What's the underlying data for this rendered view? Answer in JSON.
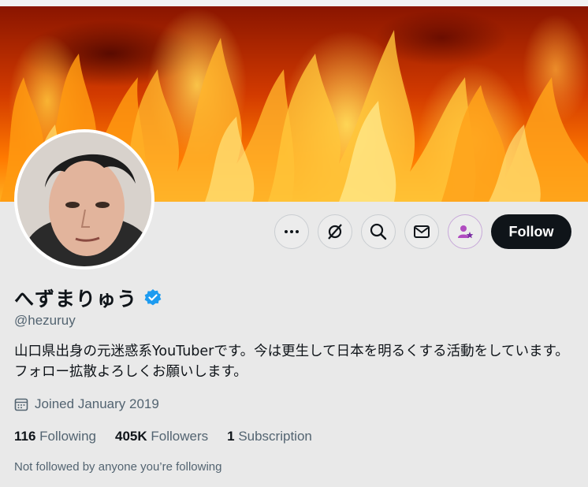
{
  "profile": {
    "display_name": "へずまりゅう",
    "handle": "@hezuruy",
    "bio": "山口県出身の元迷惑系YouTuberです。今は更生して日本を明るくする活動をしています。フォロー拡散よろしくお願いします。",
    "joined": "Joined January 2019",
    "verified_color": "#1d9bf0"
  },
  "actions": {
    "more_icon": "more-icon",
    "grok_icon": "grok-icon",
    "search_icon": "search-icon",
    "message_icon": "envelope-icon",
    "subscribe_icon": "subscribe-star-icon",
    "follow_label": "Follow"
  },
  "stats": {
    "following_count": "116",
    "following_label": "Following",
    "followers_count": "405K",
    "followers_label": "Followers",
    "subscription_count": "1",
    "subscription_label": "Subscription"
  },
  "footer": {
    "not_followed": "Not followed by anyone you’re following"
  }
}
